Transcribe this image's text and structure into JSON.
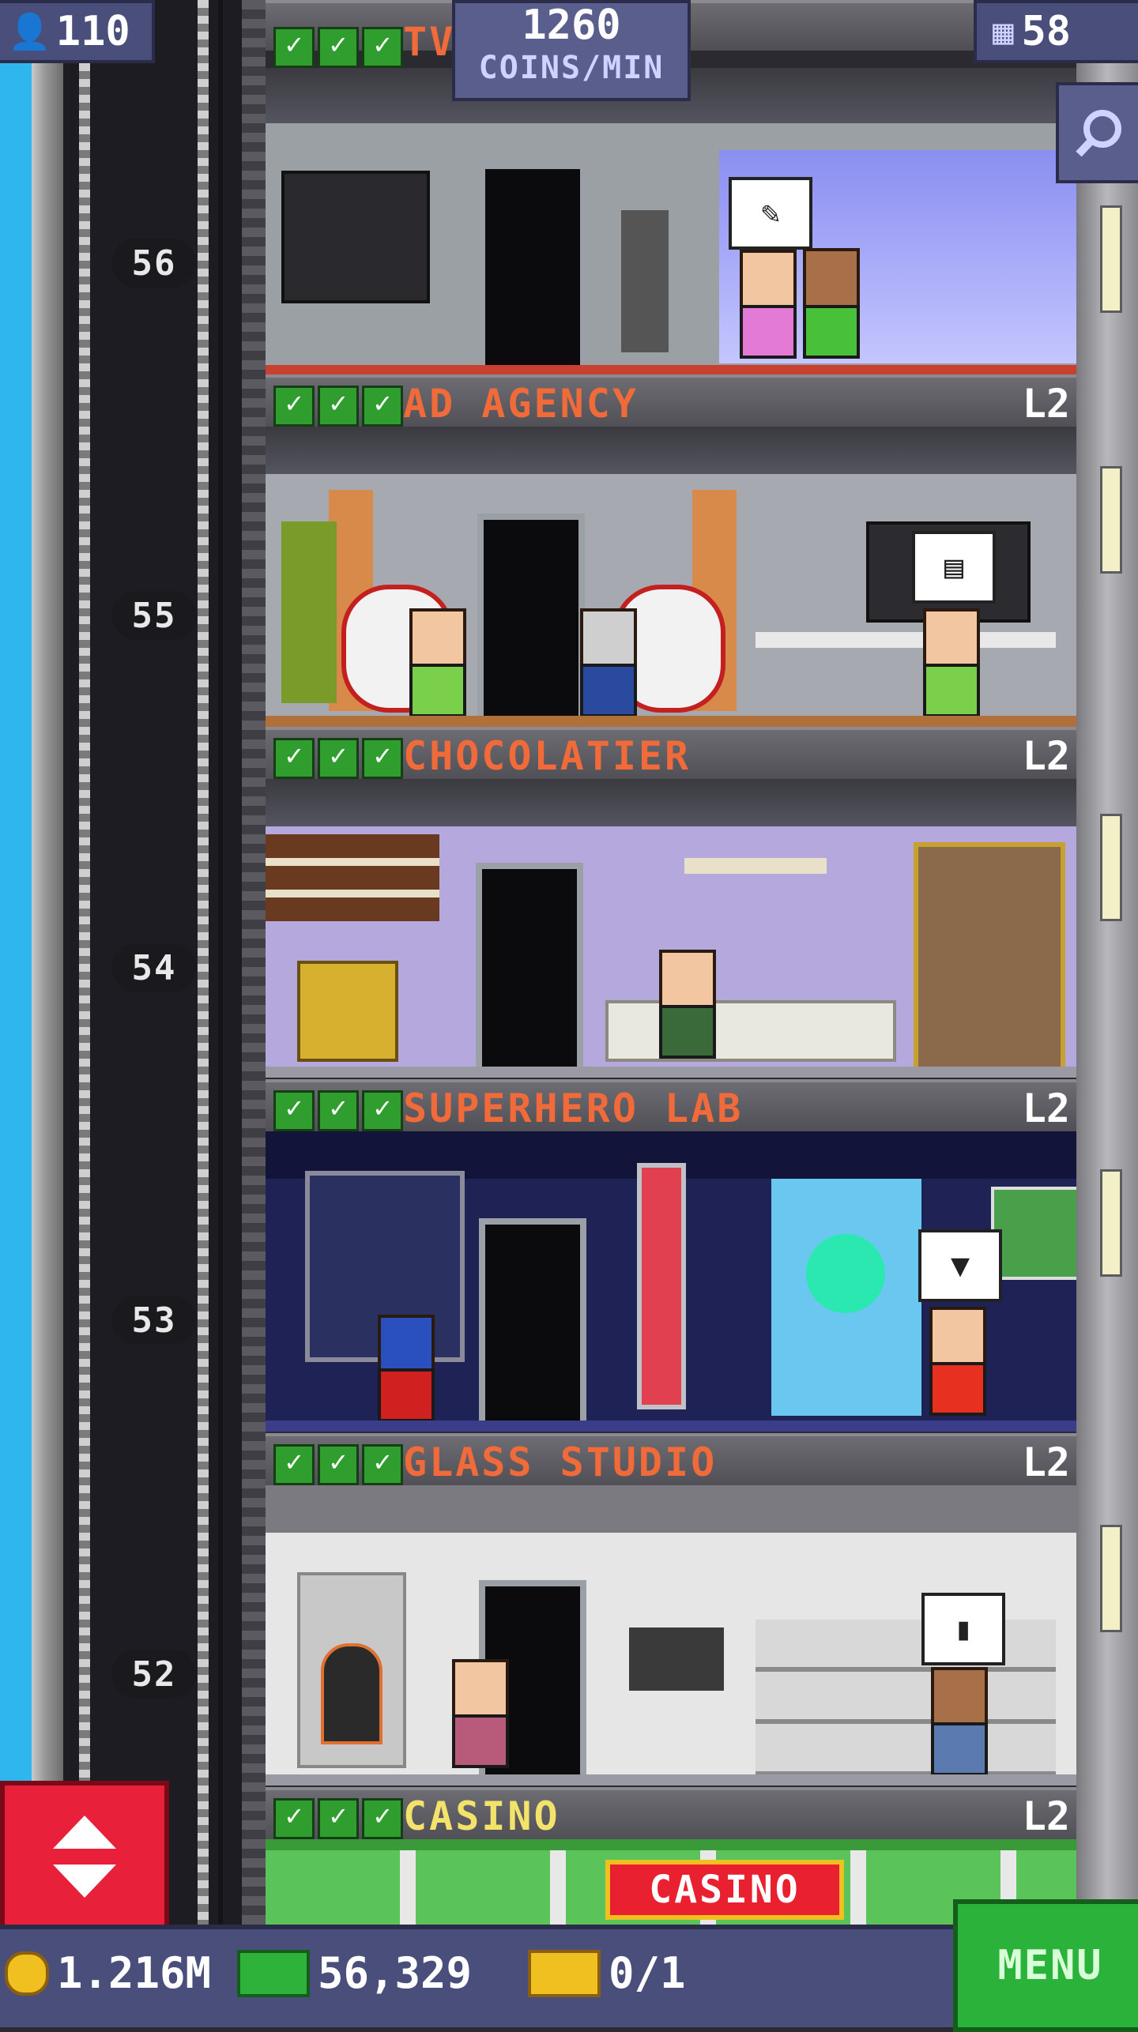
{
  "hud": {
    "population": "110",
    "coins_per_min_value": "1260",
    "coins_per_min_unit": "COINS/MIN",
    "floors": "58"
  },
  "shaft": {
    "floor_numbers": [
      "56",
      "55",
      "54",
      "53",
      "52"
    ]
  },
  "floors": [
    {
      "name": "TV",
      "level": ""
    },
    {
      "name": "AD AGENCY",
      "level": "L2"
    },
    {
      "name": "CHOCOLATIER",
      "level": "L2"
    },
    {
      "name": "SUPERHERO LAB",
      "level": "L2"
    },
    {
      "name": "GLASS STUDIO",
      "level": "L2"
    },
    {
      "name": "CASINO",
      "level": "L2"
    }
  ],
  "casino_sign": "CASINO",
  "bottom": {
    "coins": "1.216M",
    "bux": "56,329",
    "vip": "0/1",
    "menu": "MENU"
  },
  "colors": {
    "hud_bg": "#4a4e7a",
    "floor_label": "#f06a3a",
    "casino_label": "#f3e36a",
    "menu_green": "#2bb23a",
    "elevator_red": "#e8203a"
  }
}
